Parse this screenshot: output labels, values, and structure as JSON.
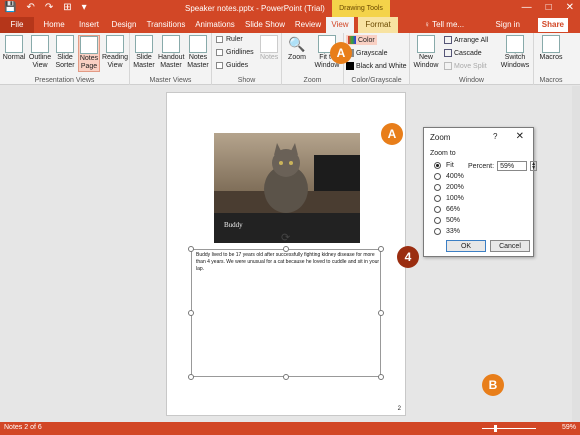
{
  "titlebar": {
    "title": "Speaker notes.pptx - PowerPoint (Trial)",
    "context_tab": "Drawing Tools",
    "min": "—",
    "max": "□",
    "close": "✕",
    "qat": [
      "💾",
      "↶",
      "↷",
      "⊞",
      "▾"
    ]
  },
  "tabs": {
    "file": "File",
    "home": "Home",
    "insert": "Insert",
    "design": "Design",
    "transitions": "Transitions",
    "animations": "Animations",
    "slideshow": "Slide Show",
    "review": "Review",
    "view": "View",
    "format": "Format",
    "tellme": "♀ Tell me...",
    "signin": "Sign in",
    "share": "Share"
  },
  "ribbon": {
    "presentation_views": {
      "label": "Presentation Views",
      "normal": "Normal",
      "outline": "Outline View",
      "sorter": "Slide Sorter",
      "notes": "Notes Page",
      "reading": "Reading View"
    },
    "master_views": {
      "label": "Master Views",
      "slide": "Slide Master",
      "handout": "Handout Master",
      "notes": "Notes Master"
    },
    "show": {
      "label": "Show",
      "ruler": "Ruler",
      "gridlines": "Gridlines",
      "guides": "Guides",
      "notes": "Notes"
    },
    "zoom": {
      "label": "Zoom",
      "zoom": "Zoom",
      "fit": "Fit to Window"
    },
    "color": {
      "label": "Color/Grayscale",
      "color": "Color",
      "grayscale": "Grayscale",
      "bw": "Black and White"
    },
    "window": {
      "label": "Window",
      "new": "New Window",
      "arrange": "Arrange All",
      "cascade": "Cascade",
      "movesplit": "Move Split",
      "switch": "Switch Windows"
    },
    "macros": {
      "label": "Macros",
      "macros": "Macros"
    }
  },
  "slide": {
    "caption": "Buddy"
  },
  "notes": {
    "text": "Buddy lived to be 17 years old after successfully fighting kidney disease for more than 4 years. We were unusual for a cat because he loved to cuddle and sit in your lap.",
    "page_number": "2"
  },
  "dialog": {
    "title": "Zoom",
    "help": "?",
    "close": "✕",
    "zoom_to": "Zoom to",
    "options": [
      "Fit",
      "400%",
      "200%",
      "100%",
      "66%",
      "50%",
      "33%"
    ],
    "percent_label": "Percent:",
    "percent_value": "59%",
    "ok": "OK",
    "cancel": "Cancel"
  },
  "callouts": {
    "a1": "A",
    "a2": "A",
    "four": "4",
    "b": "B"
  },
  "status": {
    "left": "Notes 2 of 6",
    "zoom": "59%"
  }
}
